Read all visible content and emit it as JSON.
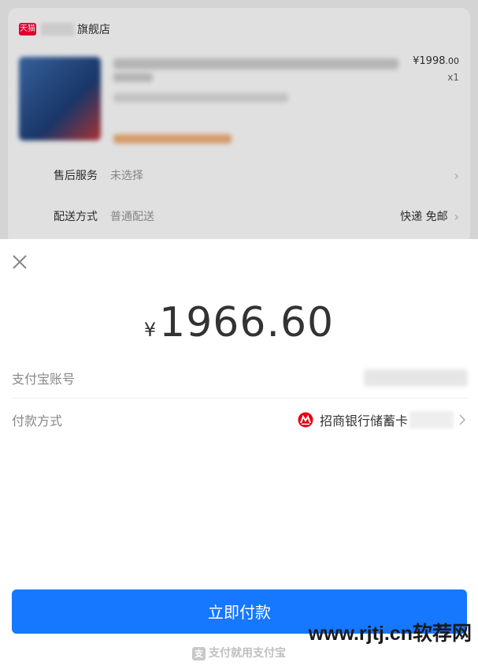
{
  "order": {
    "store_badge": "天猫",
    "store_name": "旗舰店",
    "price_main": "¥1998",
    "price_decimal": ".00",
    "quantity": "x1",
    "after_sales": {
      "label": "售后服务",
      "value": "未选择"
    },
    "delivery": {
      "label": "配送方式",
      "value": "普通配送",
      "right": "快递 免邮"
    }
  },
  "payment": {
    "currency": "¥",
    "amount": "1966.60",
    "account_label": "支付宝账号",
    "method_label": "付款方式",
    "method_value": "招商银行储蓄卡",
    "pay_button": "立即付款",
    "footer_brand": "支付就用支付宝",
    "footer_logo": "支"
  },
  "watermark": "www.rjtj.cn软荐网",
  "colors": {
    "primary": "#1677ff",
    "tmall": "#ff0036",
    "cmb": "#e60012"
  },
  "icons": {
    "close": "close-icon",
    "bank": "cmb-bank-icon",
    "chevron": "chevron-right-icon"
  }
}
